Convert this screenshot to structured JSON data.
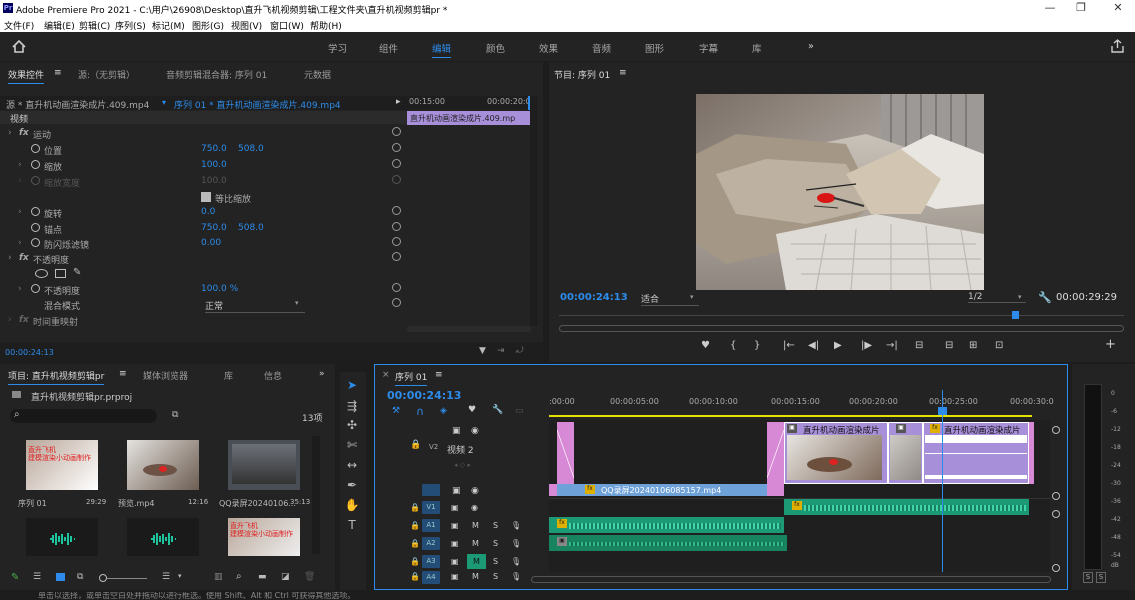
{
  "window": {
    "title": "Adobe Premiere Pro 2021 - C:\\用户\\26908\\Desktop\\直升飞机视频剪辑\\工程文件夹\\直升机视频剪辑pr *",
    "logo": "Pr",
    "min": "—",
    "max": "❐",
    "close": "✕"
  },
  "menu": [
    "文件(F)",
    "编辑(E)",
    "剪辑(C)",
    "序列(S)",
    "标记(M)",
    "图形(G)",
    "视图(V)",
    "窗口(W)",
    "帮助(H)"
  ],
  "workspaces": [
    "学习",
    "组件",
    "编辑",
    "颜色",
    "效果",
    "音频",
    "图形",
    "字幕",
    "库"
  ],
  "workspace_more": "»",
  "effect_controls": {
    "tabs": [
      "效果控件",
      "源:（无剪辑）",
      "音频剪辑混合器: 序列 01",
      "元数据"
    ],
    "tab_menu": "≡",
    "source": "源 * 直升机动画渲染成片.409.mp4",
    "sequence": "序列 01 * 直升机动画渲染成片.409.mp4",
    "ruler": [
      "00:15:00",
      "00:00:20:0"
    ],
    "clip_label": "直升机动画渲染成片.409.mp",
    "video_header": "视频",
    "motion": "运动",
    "position_label": "位置",
    "position_x": "750.0",
    "position_y": "508.0",
    "scale_label": "缩放",
    "scale": "100.0",
    "scale_width_label": "缩放宽度",
    "scale_width": "100.0",
    "uniform_label": "等比缩放",
    "rotation_label": "旋转",
    "rotation": "0.0",
    "anchor_label": "锚点",
    "anchor_x": "750.0",
    "anchor_y": "508.0",
    "flicker_label": "防闪烁滤镜",
    "flicker": "0.00",
    "opacity_header": "不透明度",
    "opacity_label": "不透明度",
    "opacity": "100.0 %",
    "blend_label": "混合模式",
    "blend": "正常",
    "time_remap": "时间重映射",
    "timecode": "00:00:24:13"
  },
  "program": {
    "title": "节目: 序列 01",
    "menu": "≡",
    "timecode": "00:00:24:13",
    "fit": "适合",
    "quality": "1/2",
    "duration": "00:00:29:29",
    "controls": [
      "♥",
      "{",
      "}",
      "|←",
      "◀|",
      "▶",
      "|▶",
      "→|",
      "⊟",
      "⊟",
      "⊞",
      "⊡",
      "📷",
      "+"
    ]
  },
  "project": {
    "tabs": [
      "项目: 直升机视频剪辑pr",
      "媒体浏览器",
      "库",
      "信息"
    ],
    "menu": "≡",
    "more": "»",
    "file": "直升机视频剪辑pr.prproj",
    "count": "13项",
    "items": [
      {
        "name": "序列 01",
        "dur": "29:29",
        "caption": "直升飞机\n建模渲染小动画制作"
      },
      {
        "name": "预览.mp4",
        "dur": "12:16",
        "caption": ""
      },
      {
        "name": "QQ录屏20240106...",
        "dur": "35:13",
        "caption": ""
      }
    ],
    "row2_caption": "直升飞机\n建模渲染小动画制作"
  },
  "timeline": {
    "tab": "序列 01",
    "tab_close": "×",
    "menu": "≡",
    "timecode": "00:00:24:13",
    "ruler": [
      ":00:00",
      "00:00:05:00",
      "00:00:10:00",
      "00:00:15:00",
      "00:00:20:00",
      "00:00:25:00",
      "00:00:30:0"
    ],
    "tracks": {
      "v2": "V2",
      "v2_name": "视频 2",
      "v1": "V1",
      "a1": "A1",
      "a2": "A2",
      "a3": "A3",
      "a4": "A4"
    },
    "lock": "🔒",
    "m": "M",
    "s": "S",
    "clips": {
      "heli1": "直升机动画渲染成片",
      "heli2": "直升机动画渲染成片",
      "qq": "QQ录屏20240106085157.mp4",
      "fx": "fx"
    }
  },
  "meter": {
    "labels": [
      "0",
      "-6",
      "-12",
      "-18",
      "-24",
      "-30",
      "-36",
      "-42",
      "-48",
      "-54"
    ],
    "dB": "dB",
    "s1": "S",
    "s2": "S"
  },
  "status": "单击以选择，或单击空白处并拖动以进行框选。使用 Shift、Alt 和 Ctrl 可获得其他选项。",
  "colors": {
    "blue": "#2d8ceb",
    "pink": "#d889d5",
    "purple": "#a88fd9",
    "green": "#1c9a75"
  }
}
